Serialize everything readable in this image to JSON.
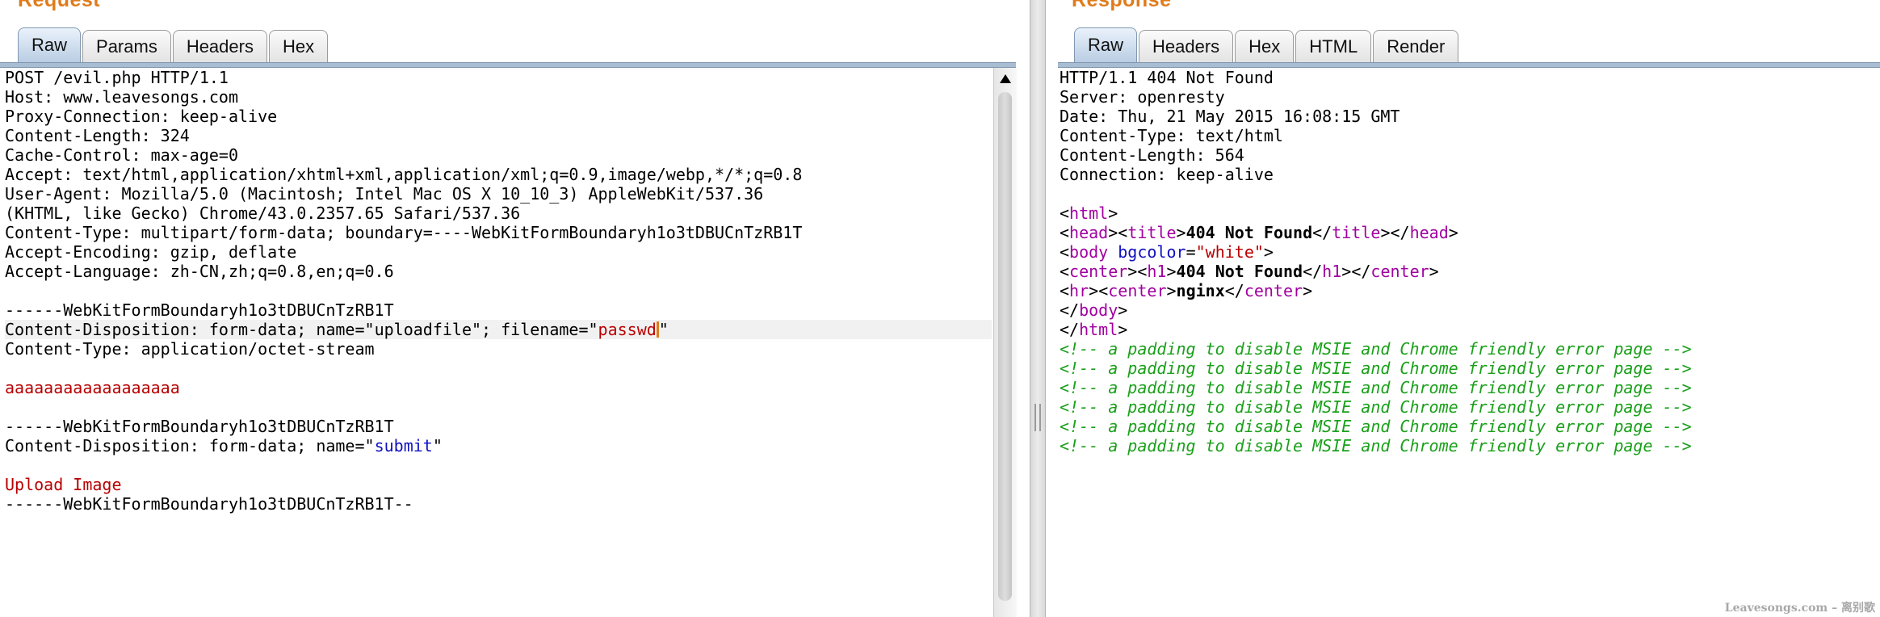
{
  "request": {
    "title": "Request",
    "tabs": [
      "Raw",
      "Params",
      "Headers",
      "Hex"
    ],
    "lines": {
      "l1": "POST /evil.php HTTP/1.1",
      "l2": "Host: www.leavesongs.com",
      "l3": "Proxy-Connection: keep-alive",
      "l4": "Content-Length: 324",
      "l5": "Cache-Control: max-age=0",
      "l6": "Accept: text/html,application/xhtml+xml,application/xml;q=0.9,image/webp,*/*;q=0.8",
      "l7": "User-Agent: Mozilla/5.0 (Macintosh; Intel Mac OS X 10_10_3) AppleWebKit/537.36",
      "l8": "(KHTML, like Gecko) Chrome/43.0.2357.65 Safari/537.36",
      "l9": "Content-Type: multipart/form-data; boundary=----WebKitFormBoundaryh1o3tDBUCnTzRB1T",
      "l10": "Accept-Encoding: gzip, deflate",
      "l11": "Accept-Language: zh-CN,zh;q=0.8,en;q=0.6",
      "boundary": "------WebKitFormBoundaryh1o3tDBUCnTzRB1T",
      "disp1_pre": "Content-Disposition: form-data; name=",
      "disp1_name": "\"uploadfile\"",
      "disp1_mid": "; filename=",
      "disp1_q1": "\"",
      "disp1_filename": "passwd",
      "disp1_q2": "\"",
      "ctype": "Content-Type: application/octet-stream",
      "payload": "aaaaaaaaaaaaaaaaaa",
      "disp2_pre": "Content-Disposition: form-data; name=",
      "disp2_q1": "\"",
      "disp2_name": "submit",
      "disp2_q2": "\"",
      "upload": "Upload Image",
      "boundary_end": "------WebKitFormBoundaryh1o3tDBUCnTzRB1T--"
    }
  },
  "response": {
    "title": "Response",
    "tabs": [
      "Raw",
      "Headers",
      "Hex",
      "HTML",
      "Render"
    ],
    "headers": [
      "HTTP/1.1 404 Not Found",
      "Server: openresty",
      "Date: Thu, 21 May 2015 16:08:15 GMT",
      "Content-Type: text/html",
      "Content-Length: 564",
      "Connection: keep-alive"
    ],
    "html": {
      "lt": "<",
      "gt": ">",
      "lt_slash": "</",
      "html": "html",
      "head": "head",
      "title": "title",
      "title_text": "404 Not Found",
      "body": "body",
      "bgcolor": "bgcolor",
      "eq": "=",
      "white": "\"white\"",
      "center": "center",
      "h1": "h1",
      "h1_text": "404 Not Found",
      "hr": "hr",
      "nginx": "nginx"
    },
    "comment": "<!-- a padding to disable MSIE and Chrome friendly error page -->"
  },
  "watermark": "Leavesongs.com – 离别歌",
  "colors": {
    "title_orange": "#e07b1a",
    "string_red": "#b80000",
    "attr_blue": "#1010c0",
    "tag_magenta": "#a000a0",
    "comment_green": "#1aa01a"
  }
}
